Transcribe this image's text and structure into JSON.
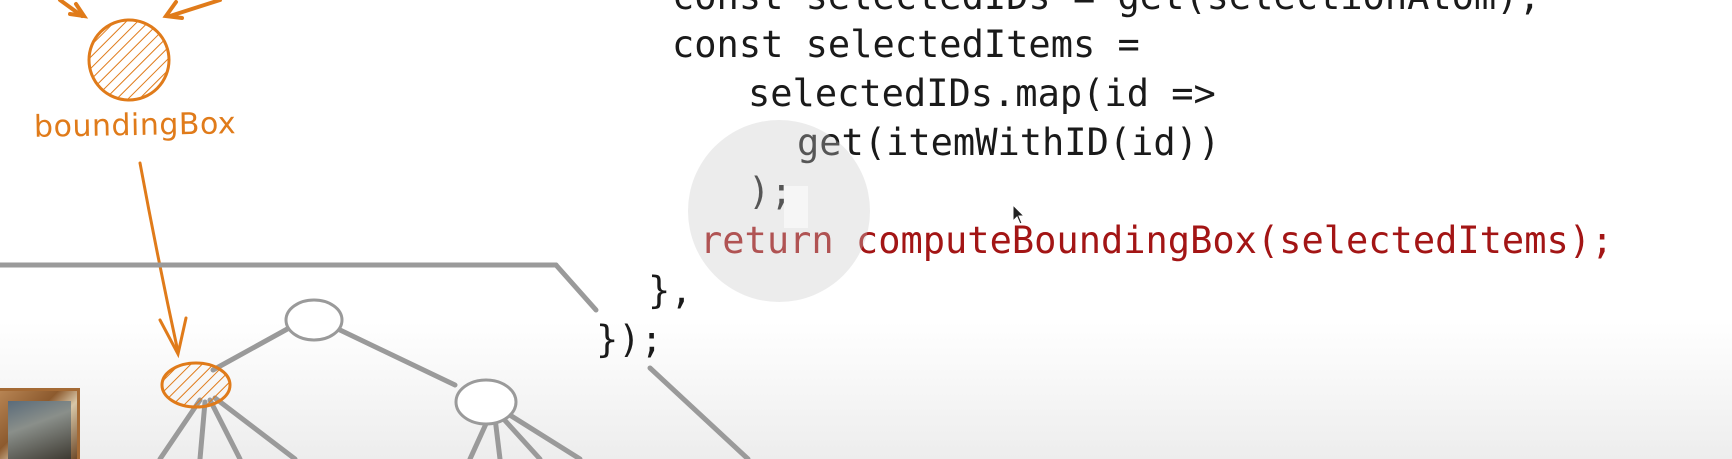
{
  "code": {
    "line_partial": "const selectedIDs = get(selectionAtom);",
    "line1": "const selectedItems =",
    "line2": "selectedIDs.map(id =>",
    "line3": "get(itemWithID(id))",
    "line4": ");",
    "line5": "return computeBoundingBox(selectedItems);",
    "line6": "},",
    "line7": "});"
  },
  "diagram": {
    "node_label": "boundingBox",
    "accent_color": "#e07b1a",
    "edge_color": "#9a9a9a"
  },
  "overlay": {
    "icon": "pause-icon"
  },
  "pointer": {
    "icon": "mouse-cursor-icon"
  },
  "thumbnail": {
    "icon": "painting-thumbnail"
  }
}
